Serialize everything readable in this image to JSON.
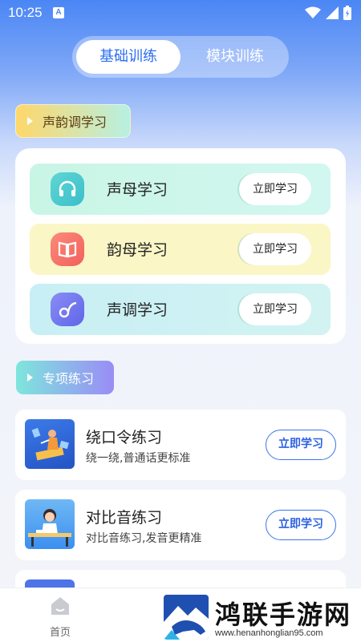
{
  "status_bar": {
    "time": "10:25",
    "notif_letter": "A"
  },
  "tabs": [
    {
      "label": "基础训练",
      "active": true
    },
    {
      "label": "模块训练",
      "active": false
    }
  ],
  "section_phonetics": {
    "title": "声韵调学习"
  },
  "phonetic_rows": [
    {
      "label": "声母学习",
      "button": "立即学习",
      "icon": "headphones-icon"
    },
    {
      "label": "韵母学习",
      "button": "立即学习",
      "icon": "book-icon"
    },
    {
      "label": "声调学习",
      "button": "立即学习",
      "icon": "music-note-icon"
    }
  ],
  "section_practice": {
    "title": "专项练习"
  },
  "practice_items": [
    {
      "title": "绕口令练习",
      "subtitle": "绕一绕,普通话更标准",
      "button": "立即学习"
    },
    {
      "title": "对比音练习",
      "subtitle": "对比音练习,发音更精准",
      "button": "立即学习"
    }
  ],
  "bottom_nav": {
    "home_label": "首页"
  },
  "watermark": {
    "title": "鸿联手游网",
    "url": "www.henanhonglian95.com"
  },
  "colors": {
    "accent": "#2c6df2",
    "brand_blue": "#4a86f5"
  }
}
